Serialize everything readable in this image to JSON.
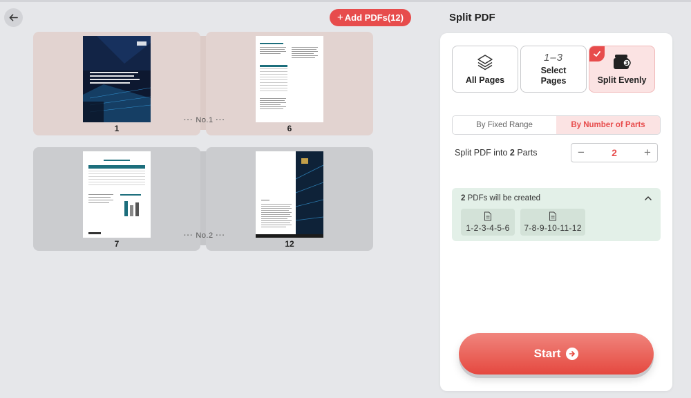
{
  "header": {
    "add_pdfs_label": "Add PDFs(12)",
    "add_icon": "+"
  },
  "groups": [
    {
      "label": "No.1",
      "pages": [
        {
          "number": "1",
          "thumb_type": "cover-dark"
        },
        {
          "number": "6",
          "thumb_type": "text-table"
        }
      ]
    },
    {
      "label": "No.2",
      "pages": [
        {
          "number": "7",
          "thumb_type": "table-chart"
        },
        {
          "number": "12",
          "thumb_type": "text-image"
        }
      ]
    }
  ],
  "panel": {
    "title": "Split PDF",
    "modes": [
      {
        "label": "All Pages",
        "icon": "layers-icon"
      },
      {
        "label": "Select Pages",
        "icon": "range-icon",
        "range_text": "1–3"
      },
      {
        "label": "Split Evenly",
        "icon": "wallet-split-icon",
        "selected": true
      }
    ],
    "segmented": {
      "option1": "By Fixed Range",
      "option2": "By Number of Parts",
      "selected": "By Number of Parts"
    },
    "split_into": {
      "prefix": "Split PDF into",
      "parts_value": "2",
      "suffix": "Parts"
    },
    "stepper": {
      "minus": "−",
      "plus": "+",
      "value": "2"
    },
    "result": {
      "count": "2",
      "text": "PDFs will be created",
      "files": [
        "1-2-3-4-5-6",
        "7-8-9-10-11-12"
      ]
    },
    "start_label": "Start"
  },
  "colors": {
    "accent": "#e74c4c",
    "group1_bg": "#e2d3d0",
    "group2_bg": "#cbcccf",
    "result_bg": "#e3f0e8"
  }
}
